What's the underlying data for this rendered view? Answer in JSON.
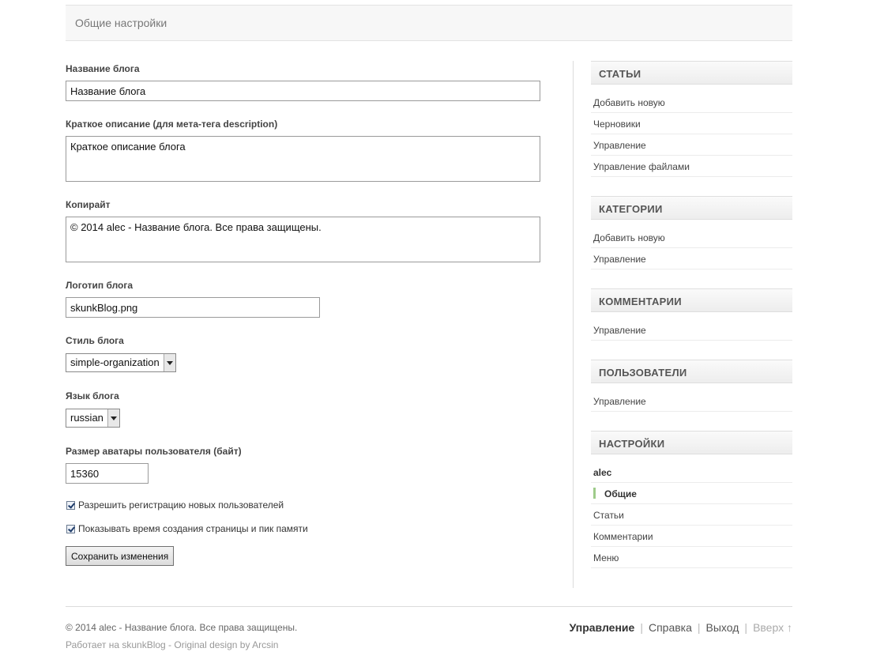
{
  "header": {
    "title": "Общие настройки"
  },
  "form": {
    "blog_name": {
      "label": "Название блога",
      "value": "Название блога"
    },
    "description": {
      "label": "Краткое описание (для мета-тега description)",
      "value": "Краткое описание блога"
    },
    "copyright": {
      "label": "Копирайт",
      "value": "© 2014 alec - Название блога. Все права защищены."
    },
    "logo": {
      "label": "Логотип блога",
      "value": "skunkBlog.png"
    },
    "style": {
      "label": "Стиль блога",
      "value": "simple-organization"
    },
    "language": {
      "label": "Язык блога",
      "value": "russian"
    },
    "avatar_size": {
      "label": "Размер аватары пользователя (байт)",
      "value": "15360"
    },
    "allow_registration": {
      "label": "Разрешить регистрацию новых пользователей",
      "checked": true
    },
    "show_stats": {
      "label": "Показывать время создания страницы и пик памяти",
      "checked": true
    },
    "save_label": "Сохранить изменения"
  },
  "sidebar": {
    "articles": {
      "title": "СТАТЬИ",
      "items": [
        "Добавить новую",
        "Черновики",
        "Управление",
        "Управление файлами"
      ]
    },
    "categories": {
      "title": "КАТЕГОРИИ",
      "items": [
        "Добавить новую",
        "Управление"
      ]
    },
    "comments": {
      "title": "КОММЕНТАРИИ",
      "items": [
        "Управление"
      ]
    },
    "users": {
      "title": "ПОЛЬЗОВАТЕЛИ",
      "items": [
        "Управление"
      ]
    },
    "settings": {
      "title": "НАСТРОЙКИ",
      "user": "alec",
      "active": "Общие",
      "items": [
        "Статьи",
        "Комментарии",
        "Меню"
      ]
    }
  },
  "footer": {
    "copyright": "© 2014 alec - Название блога. Все права защищены.",
    "powered_prefix": "Работает на ",
    "powered_link": "skunkBlog",
    "design_sep": " - ",
    "design_link": "Original design by Arcsin",
    "nav": {
      "manage": "Управление",
      "help": "Справка",
      "logout": "Выход",
      "up": "Вверх ↑",
      "separator": "|"
    }
  }
}
